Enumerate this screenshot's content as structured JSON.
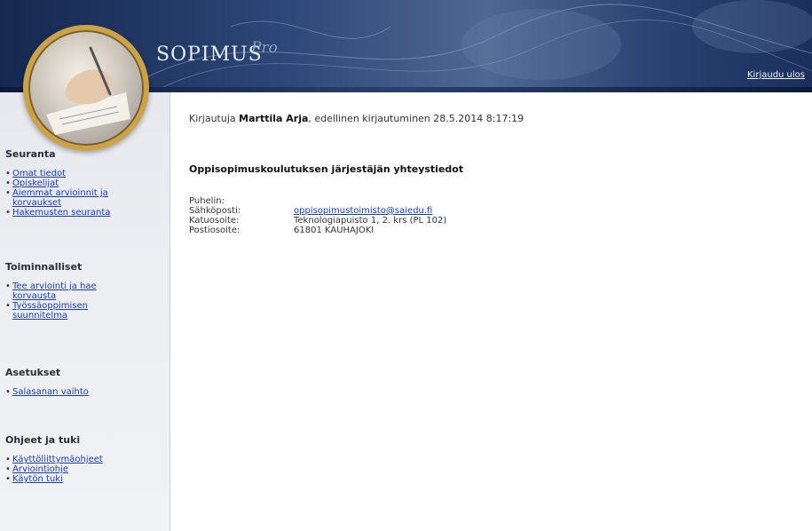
{
  "header": {
    "app_name": "SOPIMUS",
    "app_name_script": "Pro",
    "logout_label": "Kirjaudu ulos"
  },
  "sidebar": {
    "sections": [
      {
        "heading": "Seuranta",
        "items": [
          "Omat tiedot",
          "Opiskelijat",
          "Aiemmat arvioinnit ja korvaukset",
          "Hakemusten seuranta"
        ]
      },
      {
        "heading": "Toiminnalliset",
        "items": [
          "Tee arviointi ja hae korvausta",
          "Työssäoppimisen suunnitelma"
        ]
      },
      {
        "heading": "Asetukset",
        "items": [
          "Salasanan vaihto"
        ]
      },
      {
        "heading": "Ohjeet ja tuki",
        "items": [
          "Käyttöliittymäohjeet",
          "Arviointiohje",
          "Käytön tuki"
        ]
      }
    ]
  },
  "main": {
    "login_prefix": "Kirjautuja",
    "login_user": "Marttila Arja",
    "login_suffix": ", edellinen kirjautuminen 28.5.2014 8:17:19",
    "contact_title": "Oppisopimuskoulutuksen järjestäjän yhteystiedot",
    "contact": [
      {
        "label": "Puhelin:",
        "value": ""
      },
      {
        "label": "Sähköposti:",
        "value": "oppisopimustoimisto@saiedu.fi",
        "link": true
      },
      {
        "label": "Katuosoite:",
        "value": "Teknologiapuisto 1, 2. krs (PL 102)"
      },
      {
        "label": "Postiosoite:",
        "value": "61801 KAUHAJOKI"
      }
    ]
  },
  "colors": {
    "banner_dark": "#15284f",
    "banner_light": "#4f6893",
    "link": "#1a3bbf",
    "sidebar_bg": "#eceef2",
    "logo_ring": "#c9a24a"
  }
}
